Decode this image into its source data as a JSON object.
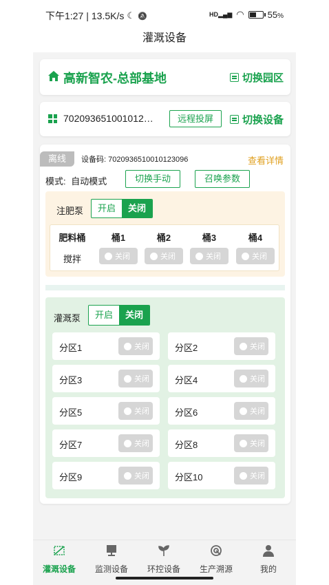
{
  "status_bar": {
    "time": "下午1:27",
    "speed": "13.5K/s",
    "moon": "☾",
    "bell_off": "🔕",
    "signal": "HD",
    "battery": "55",
    "battery_unit": "%",
    "battery_level": 0.55
  },
  "header": {
    "title": "灌溉设备"
  },
  "base": {
    "name": "高新智农-总部基地",
    "switch_label": "切换园区"
  },
  "device": {
    "code": "702093651001012…",
    "remote_label": "远程投屏",
    "switch_label": "切换设备"
  },
  "panel": {
    "status": "离线",
    "code_label": "设备码: 7020936510010123096",
    "detail_label": "查看详情",
    "mode_label": "模式:",
    "mode_value": "自动模式",
    "switch_manual": "切换手动",
    "summon_params": "召唤参数"
  },
  "fertilizer": {
    "label": "注肥泵",
    "on": "开启",
    "off": "关闭",
    "headers": [
      "肥料桶",
      "桶1",
      "桶2",
      "桶3",
      "桶4"
    ],
    "row_label": "搅拌",
    "toggles": [
      "关闭",
      "关闭",
      "关闭",
      "关闭"
    ]
  },
  "irrigation": {
    "label": "灌溉泵",
    "on": "开启",
    "off": "关闭",
    "zones": [
      {
        "name": "分区1",
        "state": "关闭"
      },
      {
        "name": "分区2",
        "state": "关闭"
      },
      {
        "name": "分区3",
        "state": "关闭"
      },
      {
        "name": "分区4",
        "state": "关闭"
      },
      {
        "name": "分区5",
        "state": "关闭"
      },
      {
        "name": "分区6",
        "state": "关闭"
      },
      {
        "name": "分区7",
        "state": "关闭"
      },
      {
        "name": "分区8",
        "state": "关闭"
      },
      {
        "name": "分区9",
        "state": "关闭"
      },
      {
        "name": "分区10",
        "state": "关闭"
      }
    ]
  },
  "nav": {
    "items": [
      {
        "label": "灌溉设备",
        "icon": "irrigation-icon",
        "active": true
      },
      {
        "label": "监测设备",
        "icon": "monitor-icon",
        "active": false
      },
      {
        "label": "环控设备",
        "icon": "sprout-icon",
        "active": false
      },
      {
        "label": "生产溯源",
        "icon": "trace-icon",
        "active": false
      },
      {
        "label": "我的",
        "icon": "user-icon",
        "active": false
      }
    ]
  },
  "colors": {
    "accent": "#1aa24e",
    "warning": "#e0a020",
    "offline": "#bcbcbc",
    "fert_bg": "#fdf3e3",
    "irr_bg": "#e2f2e4"
  }
}
